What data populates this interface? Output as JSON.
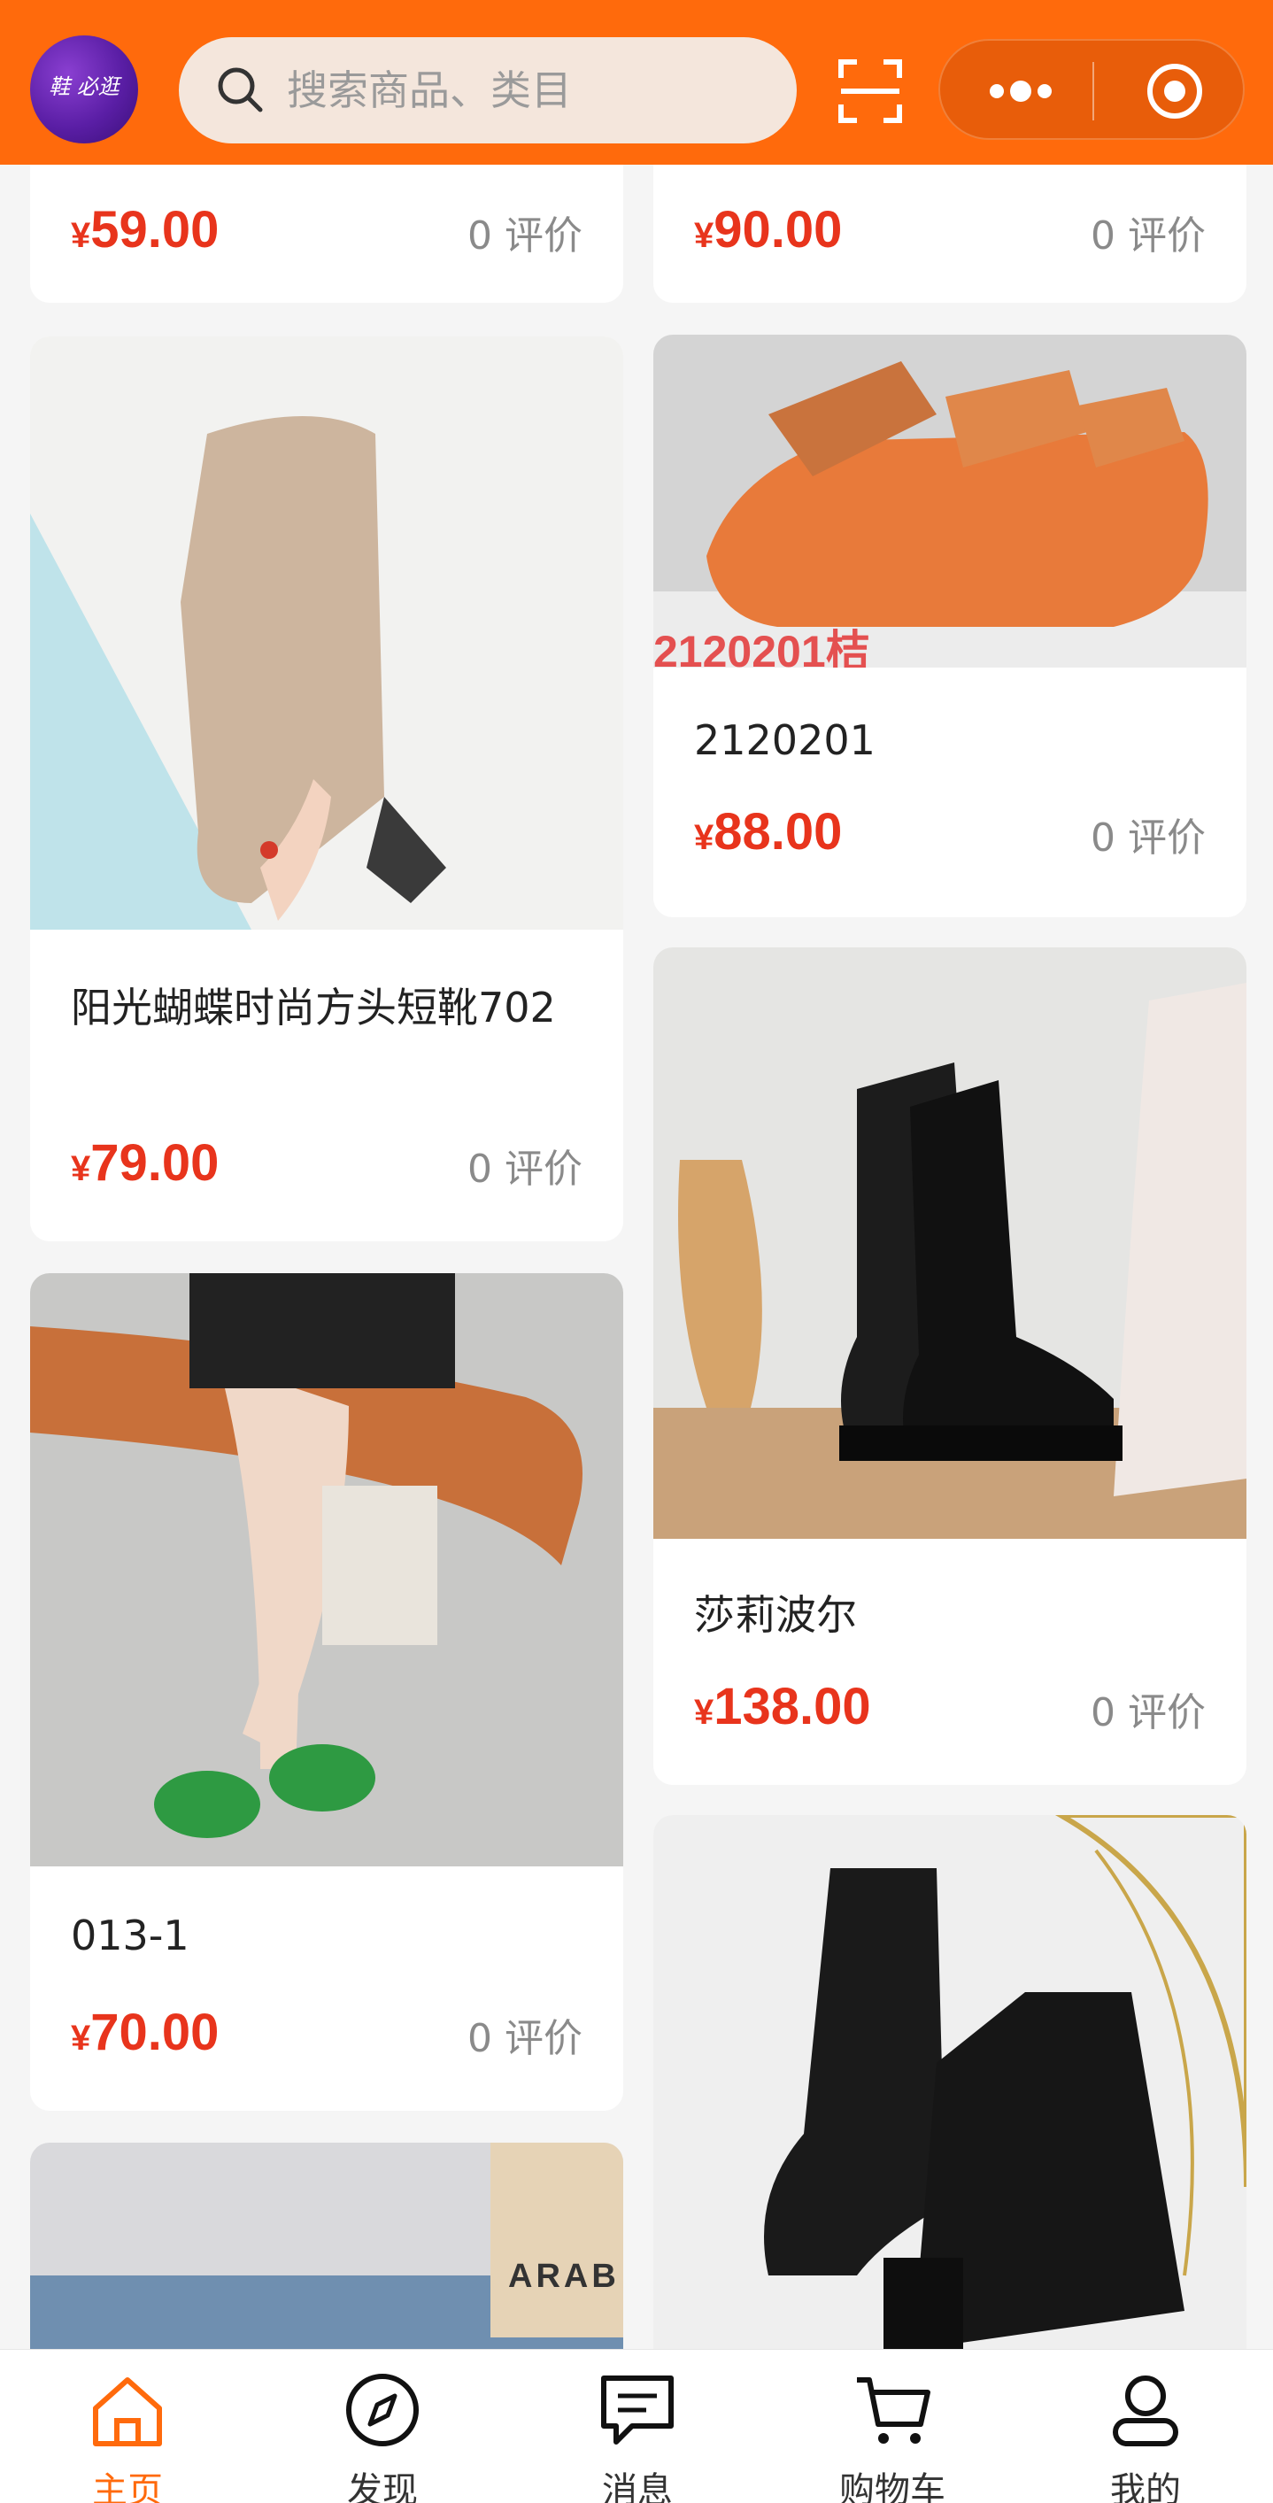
{
  "header": {
    "logo_text": "鞋 必逛",
    "search_placeholder": "搜索商品、类目",
    "icons": [
      "search-icon",
      "scan-icon",
      "more-icon",
      "target-icon"
    ]
  },
  "products": [
    {
      "title": "",
      "currency": "¥",
      "price": "59.00",
      "reviews": "0 评价"
    },
    {
      "title": "",
      "currency": "¥",
      "price": "90.00",
      "reviews": "0 评价"
    },
    {
      "title": "阳光蝴蝶时尚方头短靴702",
      "currency": "¥",
      "price": "79.00",
      "reviews": "0 评价"
    },
    {
      "title": "2120201",
      "image_label": "2120201桔",
      "currency": "¥",
      "price": "88.00",
      "reviews": "0 评价"
    },
    {
      "title": "013-1",
      "currency": "¥",
      "price": "70.00",
      "reviews": "0 评价"
    },
    {
      "title": "莎莉波尔",
      "currency": "¥",
      "price": "138.00",
      "reviews": "0 评价"
    },
    {
      "title": "",
      "image_label": "ARAB",
      "currency": "",
      "price": "",
      "reviews": ""
    },
    {
      "title": "",
      "currency": "",
      "price": "",
      "reviews": ""
    }
  ],
  "tabbar": {
    "items": [
      {
        "label": "主页",
        "icon": "home-icon",
        "active": true
      },
      {
        "label": "发现",
        "icon": "compass-icon",
        "active": false
      },
      {
        "label": "消息",
        "icon": "message-icon",
        "active": false
      },
      {
        "label": "购物车",
        "icon": "cart-icon",
        "active": false
      },
      {
        "label": "我的",
        "icon": "user-icon",
        "active": false
      }
    ]
  },
  "colors": {
    "accent": "#ff6a0c",
    "price": "#e8341c",
    "background": "#f5f5f5"
  }
}
